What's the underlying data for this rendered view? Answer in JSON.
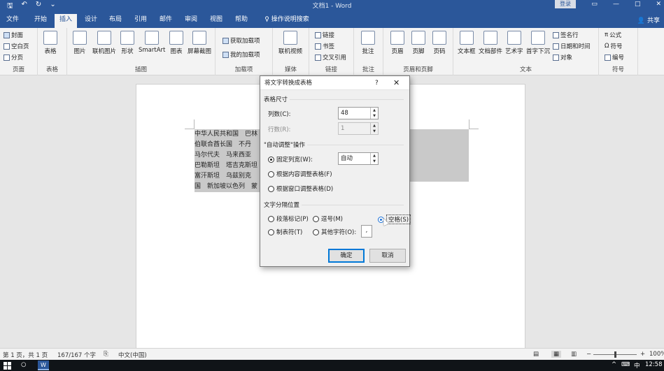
{
  "titlebar": {
    "doc_title": "文档1 - Word",
    "login": "登录",
    "qat_icons": [
      "save-icon",
      "undo-icon",
      "redo-icon",
      "customize-icon"
    ]
  },
  "tabs": {
    "items": [
      "文件",
      "开始",
      "插入",
      "设计",
      "布局",
      "引用",
      "邮件",
      "审阅",
      "视图",
      "帮助"
    ],
    "active": "插入",
    "tell_me": "操作说明搜索",
    "share": "共享"
  },
  "ribbon": {
    "groups": {
      "pages": {
        "label": "页面",
        "items": [
          "封面",
          "空白页",
          "分页"
        ]
      },
      "tables": {
        "label": "表格",
        "items": [
          "表格"
        ]
      },
      "illustrations": {
        "label": "插图",
        "items": [
          "图片",
          "联机图片",
          "形状",
          "SmartArt",
          "图表",
          "屏幕截图"
        ]
      },
      "addins": {
        "label": "加载项",
        "items": [
          "获取加载项",
          "我的加载项"
        ]
      },
      "media": {
        "label": "媒体",
        "items": [
          "联机视频"
        ]
      },
      "links": {
        "label": "链接",
        "items": [
          "链接",
          "书签",
          "交叉引用"
        ]
      },
      "comments": {
        "label": "批注",
        "items": [
          "批注"
        ]
      },
      "header_footer": {
        "label": "页眉和页脚",
        "items": [
          "页眉",
          "页脚",
          "页码"
        ]
      },
      "text": {
        "label": "文本",
        "items": [
          "文本框",
          "文档部件",
          "艺术字",
          "首字下沉",
          "签名行",
          "日期和时间",
          "对象"
        ]
      },
      "symbols": {
        "label": "符号",
        "items": [
          "公式",
          "符号",
          "编号"
        ]
      }
    }
  },
  "document": {
    "lines": [
      "中华人民共和国　巴林　　　　　　　　　　　　　　巴基斯坦　阿拉",
      "伯联合酋长国　不丹　　　　　　　　　　　　　尔　吉尔吉斯斯坦",
      "马尔代夫　马来西亚　　　　　　　　　　　　斯坦　哈萨克斯坦",
      "巴勒斯坦　塔吉克斯坦　　　　　　　　　　　亚　亚美尼亚　阿",
      "富汗斯坦　乌兹别克　　　　　　　　　　　　旦　缅甸　孟加拉",
      "国　新加坡以色列　蒙"
    ]
  },
  "dialog": {
    "title": "将文字转换成表格",
    "help": "?",
    "close": "✕",
    "table_size": {
      "heading": "表格尺寸",
      "columns_label": "列数(C):",
      "columns_value": "48",
      "rows_label": "行数(R):",
      "rows_value": "1"
    },
    "autofit": {
      "heading": "\"自动调整\"操作",
      "fixed_label": "固定列宽(W):",
      "fixed_value": "自动",
      "content_label": "根据内容调整表格(F)",
      "window_label": "根据窗口调整表格(D)"
    },
    "separator": {
      "heading": "文字分隔位置",
      "paragraph": "段落标记(P)",
      "comma": "逗号(M)",
      "space": "空格(S)",
      "tab": "制表符(T)",
      "other": "其他字符(O):",
      "other_value": ","
    },
    "ok": "确定",
    "cancel": "取消"
  },
  "status": {
    "page": "第 1 页，共 1 页",
    "words": "167/167 个字",
    "language": "中文(中国)",
    "zoom": "100%"
  },
  "taskbar": {
    "ime": "中",
    "clock": "12:58"
  },
  "colors": {
    "word_blue": "#2b579a",
    "ribbon_bg": "#f3f3f3",
    "selection": "#c9c9c9",
    "ok_border": "#0078d7"
  }
}
